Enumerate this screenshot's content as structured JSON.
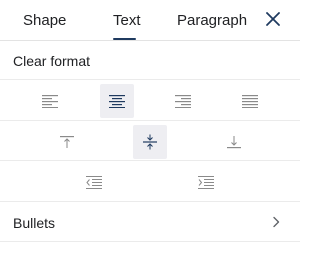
{
  "tabs": {
    "shape": "Shape",
    "text": "Text",
    "paragraph": "Paragraph",
    "active": "Text"
  },
  "close_icon": "close-icon",
  "clear_format": "Clear format",
  "alignment_icons": [
    "align-left-icon",
    "align-center-icon",
    "align-right-icon",
    "align-justify-icon"
  ],
  "alignment_selected": "align-center",
  "vertical_icons": [
    "align-top-icon",
    "align-middle-icon",
    "align-bottom-icon"
  ],
  "vertical_selected": "align-middle",
  "indent_icons": [
    "decrease-indent-icon",
    "increase-indent-icon"
  ],
  "bullets": "Bullets",
  "colors": {
    "text": "#202124",
    "icon": "#8a8a8a",
    "active_icon": "#1f3a5f",
    "selected_bg": "#eeeef2",
    "divider": "#ebebeb"
  }
}
